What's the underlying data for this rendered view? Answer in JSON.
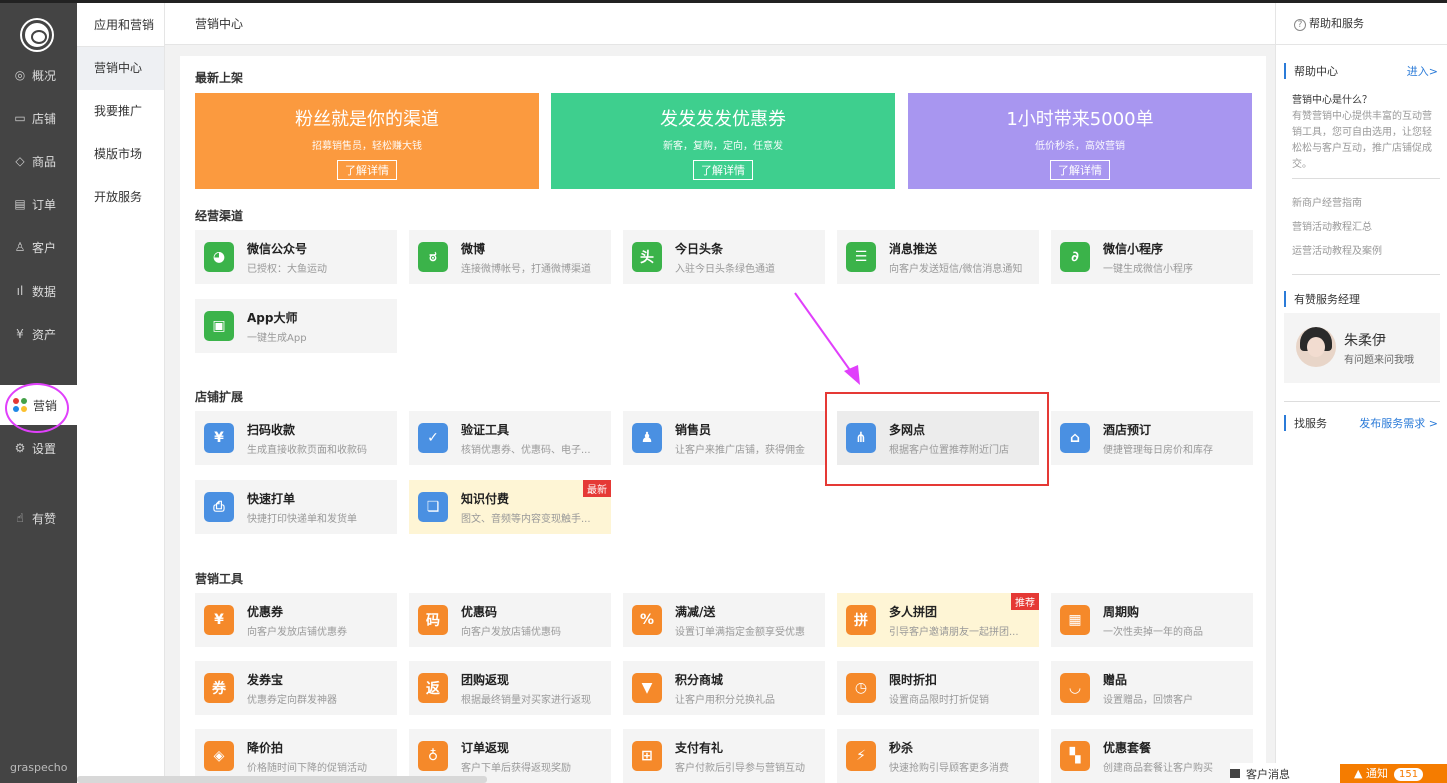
{
  "nav": {
    "items": [
      {
        "label": "概况",
        "icon": "eye-icon"
      },
      {
        "label": "店铺",
        "icon": "store-icon"
      },
      {
        "label": "商品",
        "icon": "tag-icon"
      },
      {
        "label": "订单",
        "icon": "list-icon"
      },
      {
        "label": "客户",
        "icon": "user-icon"
      },
      {
        "label": "数据",
        "icon": "bar-chart-icon"
      },
      {
        "label": "资产",
        "icon": "yen-icon"
      },
      {
        "label": "营销",
        "icon": "grid-icon"
      },
      {
        "label": "设置",
        "icon": "gear-icon"
      },
      {
        "label": "有赞",
        "icon": "thumbs-up-icon"
      }
    ],
    "footer": "graspecho"
  },
  "subnav": {
    "title": "应用和营销",
    "items": [
      "营销中心",
      "我要推广",
      "模版市场",
      "开放服务"
    ]
  },
  "header": {
    "title": "营销中心"
  },
  "main": {
    "latest_title": "最新上架",
    "banners": [
      {
        "title": "粉丝就是你的渠道",
        "subtitle": "招募销售员，轻松赚大钱",
        "button": "了解详情",
        "color": "#fb9a3f"
      },
      {
        "title": "发发发发优惠券",
        "subtitle": "新客，复购，定向，任意发",
        "button": "了解详情",
        "color": "#3ecf8e"
      },
      {
        "title": "1小时带来5000单",
        "subtitle": "低价秒杀，高效营销",
        "button": "了解详情",
        "color": "#a896f0"
      }
    ],
    "channels_title": "经营渠道",
    "channels": [
      {
        "name": "微信公众号",
        "desc": "已授权：大鱼运动",
        "color": "#3bb34a",
        "icon": "wechat-icon",
        "glyph": "◕"
      },
      {
        "name": "微博",
        "desc": "连接微博帐号，打通微博渠道",
        "color": "#3bb34a",
        "icon": "weibo-icon",
        "glyph": "ಠ"
      },
      {
        "name": "今日头条",
        "desc": "入驻今日头条绿色通道",
        "color": "#3bb34a",
        "icon": "toutiao-icon",
        "glyph": "头"
      },
      {
        "name": "消息推送",
        "desc": "向客户发送短信/微信消息通知",
        "color": "#3bb34a",
        "icon": "message-icon",
        "glyph": "☰"
      },
      {
        "name": "微信小程序",
        "desc": "一键生成微信小程序",
        "color": "#3bb34a",
        "icon": "miniprogram-icon",
        "glyph": "∂"
      },
      {
        "name": "App大师",
        "desc": "一键生成App",
        "color": "#3bb34a",
        "icon": "app-icon",
        "glyph": "▣"
      }
    ],
    "ext_title": "店铺扩展",
    "extensions": [
      {
        "name": "扫码收款",
        "desc": "生成直接收款页面和收款码",
        "color": "#4a90e2",
        "icon": "scan-pay-icon",
        "glyph": "¥"
      },
      {
        "name": "验证工具",
        "desc": "核销优惠券、优惠码、电子...",
        "color": "#4a90e2",
        "icon": "shield-check-icon",
        "glyph": "✓"
      },
      {
        "name": "销售员",
        "desc": "让客户来推广店铺，获得佣金",
        "color": "#4a90e2",
        "icon": "salesman-icon",
        "glyph": "♟"
      },
      {
        "name": "多网点",
        "desc": "根据客户位置推荐附近门店",
        "color": "#4a90e2",
        "icon": "branches-icon",
        "glyph": "⋔"
      },
      {
        "name": "酒店预订",
        "desc": "便捷管理每日房价和库存",
        "color": "#4a90e2",
        "icon": "hotel-icon",
        "glyph": "⌂"
      },
      {
        "name": "快速打单",
        "desc": "快捷打印快递单和发货单",
        "color": "#4a90e2",
        "icon": "printer-icon",
        "glyph": "⎙"
      },
      {
        "name": "知识付费",
        "desc": "图文、音频等内容变现触手...",
        "color": "#4a90e2",
        "icon": "book-icon",
        "glyph": "❏",
        "tag": "最新",
        "tag_color": "#e53935"
      }
    ],
    "tools_title": "营销工具",
    "tools": [
      {
        "name": "优惠券",
        "desc": "向客户发放店铺优惠券",
        "color": "#f5892a",
        "icon": "coupon-icon",
        "glyph": "¥"
      },
      {
        "name": "优惠码",
        "desc": "向客户发放店铺优惠码",
        "color": "#f5892a",
        "icon": "code-icon",
        "glyph": "码"
      },
      {
        "name": "满减/送",
        "desc": "设置订单满指定金额享受优惠",
        "color": "#f5892a",
        "icon": "discount-icon",
        "glyph": "%"
      },
      {
        "name": "多人拼团",
        "desc": "引导客户邀请朋友一起拼团...",
        "color": "#f5892a",
        "icon": "group-buy-icon",
        "glyph": "拼",
        "tag": "推荐",
        "tag_color": "#e53935"
      },
      {
        "name": "周期购",
        "desc": "一次性卖掉一年的商品",
        "color": "#f5892a",
        "icon": "calendar-icon",
        "glyph": "▦"
      },
      {
        "name": "发券宝",
        "desc": "优惠券定向群发神器",
        "color": "#f5892a",
        "icon": "coupon-send-icon",
        "glyph": "券"
      },
      {
        "name": "团购返现",
        "desc": "根据最终销量对买家进行返现",
        "color": "#f5892a",
        "icon": "cashback-icon",
        "glyph": "返"
      },
      {
        "name": "积分商城",
        "desc": "让客户用积分兑换礼品",
        "color": "#f5892a",
        "icon": "points-icon",
        "glyph": "▼"
      },
      {
        "name": "限时折扣",
        "desc": "设置商品限时打折促销",
        "color": "#f5892a",
        "icon": "clock-icon",
        "glyph": "◷"
      },
      {
        "name": "赠品",
        "desc": "设置赠品，回馈客户",
        "color": "#f5892a",
        "icon": "gift-bag-icon",
        "glyph": "◡"
      },
      {
        "name": "降价拍",
        "desc": "价格随时间下降的促销活动",
        "color": "#f5892a",
        "icon": "price-drop-icon",
        "glyph": "◈"
      },
      {
        "name": "订单返现",
        "desc": "客户下单后获得返现奖励",
        "color": "#f5892a",
        "icon": "money-bag-icon",
        "glyph": "♁"
      },
      {
        "name": "支付有礼",
        "desc": "客户付款后引导参与营销互动",
        "color": "#f5892a",
        "icon": "gift-icon",
        "glyph": "⊞"
      },
      {
        "name": "秒杀",
        "desc": "快速抢购引导顾客更多消费",
        "color": "#f5892a",
        "icon": "flash-icon",
        "glyph": "⚡"
      },
      {
        "name": "优惠套餐",
        "desc": "创建商品套餐让客户购买",
        "color": "#f5892a",
        "icon": "package-icon",
        "glyph": "▚"
      }
    ]
  },
  "right": {
    "title": "帮助和服务",
    "help_center": "帮助中心",
    "enter_link": "进入>",
    "question": "营销中心是什么？",
    "answer": "有赞营销中心提供丰富的互动营销工具，您可自由选用，让您轻松松与客户互动，推广店铺促成交。",
    "links": [
      "新商户经营指南",
      "营销活动教程汇总",
      "运营活动教程及案例"
    ],
    "manager_title": "有赞服务经理",
    "manager_name": "朱柔伊",
    "manager_tip": "有问题来问我哦",
    "find_service": "找服务",
    "post_demand": "发布服务需求 >"
  },
  "bottom": {
    "customer_msg": "客户消息",
    "notify": "通知",
    "notify_count": "151"
  },
  "colors": {
    "annotation": "#e040fb",
    "highlight_box": "#e53935",
    "link": "#2b7bd8"
  }
}
